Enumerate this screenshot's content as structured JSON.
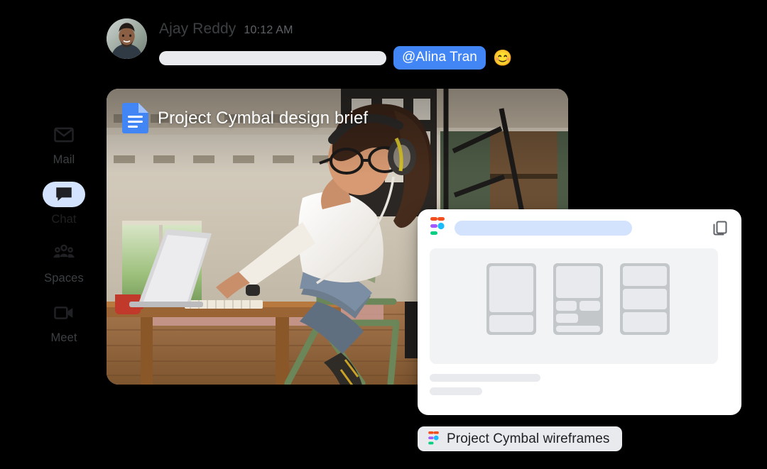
{
  "sidebar": {
    "items": [
      {
        "label": "Mail",
        "icon": "mail-icon",
        "active": false
      },
      {
        "label": "Chat",
        "icon": "chat-icon",
        "active": true
      },
      {
        "label": "Spaces",
        "icon": "spaces-icon",
        "active": false
      },
      {
        "label": "Meet",
        "icon": "meet-icon",
        "active": false
      }
    ]
  },
  "message": {
    "sender": "Ajay Reddy",
    "timestamp": "10:12 AM",
    "avatar_icon": "user-avatar-photo",
    "body_placeholder": "",
    "mention": "@Alina Tran",
    "reaction_emoji": "😊"
  },
  "doc_card": {
    "title": "Project Cymbal design brief",
    "icon": "google-docs-icon",
    "photo_alt": "woman-with-headphones-working-on-laptop"
  },
  "figma_card": {
    "logo_icon": "figma-logo-icon",
    "copy_icon": "copy-icon",
    "url_placeholder": "",
    "skeleton_lines": [
      "",
      ""
    ],
    "canvas_alt": "wireframe-frames"
  },
  "figma_chip": {
    "label": "Project Cymbal wireframes",
    "icon": "figma-logo-icon"
  },
  "colors": {
    "background": "#000000",
    "accent_blue": "#4285f4",
    "chip_light_blue": "#d3e3fd",
    "neutral_gray": "#e8eaed",
    "docs_blue": "#4285f4",
    "text_primary": "#202124",
    "text_secondary": "#5f6368",
    "figma_red": "#f24e1e",
    "figma_purple": "#a259ff",
    "figma_blue": "#1abcfe",
    "figma_green": "#0acf83"
  }
}
